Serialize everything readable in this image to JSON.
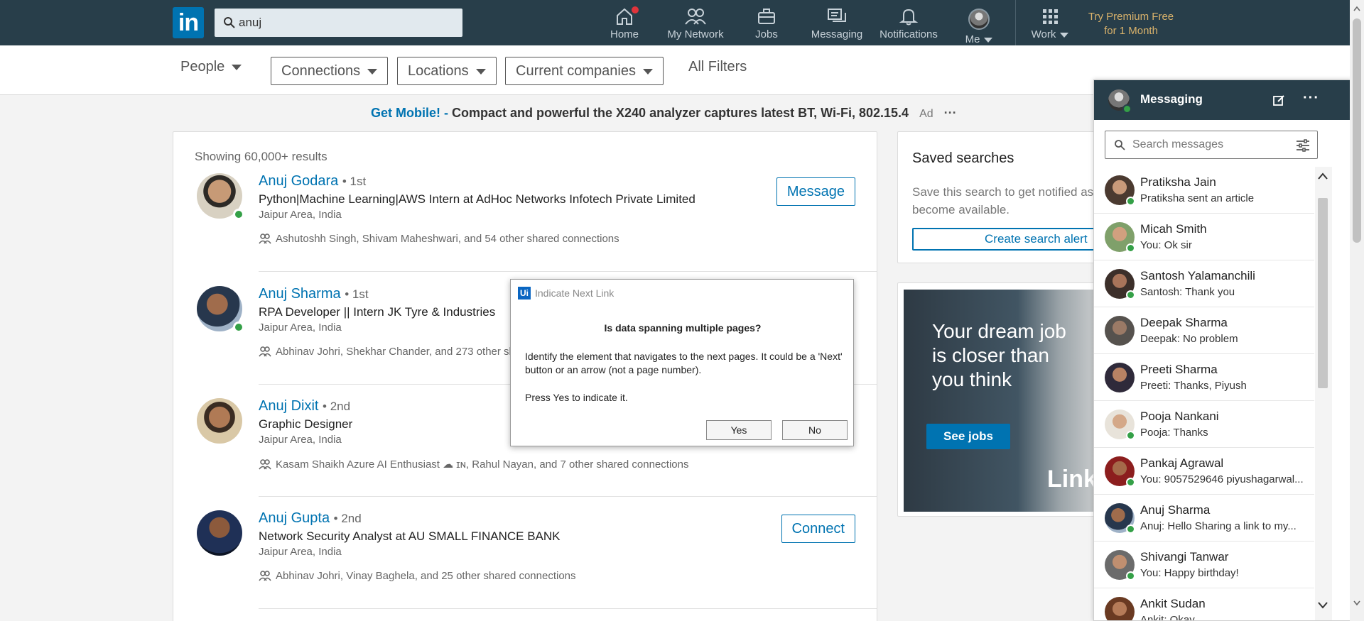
{
  "nav": {
    "search_value": "anuj",
    "items": [
      {
        "label": "Home",
        "icon": "home-icon"
      },
      {
        "label": "My Network",
        "icon": "network-icon"
      },
      {
        "label": "Jobs",
        "icon": "briefcase-icon"
      },
      {
        "label": "Messaging",
        "icon": "messaging-icon"
      },
      {
        "label": "Notifications",
        "icon": "bell-icon"
      },
      {
        "label": "Me",
        "icon": "avatar"
      },
      {
        "label": "Work",
        "icon": "grid-icon"
      }
    ],
    "premium_line1": "Try Premium Free",
    "premium_line2": "for 1 Month",
    "colors": {
      "bar": "#283e4a",
      "brand": "#0073b1",
      "premium": "#d9b26b",
      "badge": "#e0343b"
    }
  },
  "filters": {
    "people": "People",
    "buttons": [
      "Connections",
      "Locations",
      "Current companies"
    ],
    "all_filters": "All Filters"
  },
  "ad": {
    "link": "Get Mobile! -",
    "text": "Compact and powerful the X240 analyzer captures latest BT, Wi-Fi, 802.15.4",
    "tag": "Ad",
    "more": "···"
  },
  "results": {
    "count": "Showing 60,000+ results",
    "items": [
      {
        "name": "Anuj Godara",
        "degree": "• 1st",
        "title": "Python|Machine Learning|AWS Intern at AdHoc Networks Infotech Private Limited",
        "location": "Jaipur Area, India",
        "shared": "Ashutoshh Singh, Shivam Maheshwari, and 54 other shared connections",
        "button": "Message"
      },
      {
        "name": "Anuj Sharma",
        "degree": "• 1st",
        "title": "RPA Developer || Intern JK Tyre & Industries",
        "location": "Jaipur Area, India",
        "shared": "Abhinav Johri, Shekhar Chander, and 273 other sh",
        "button": ""
      },
      {
        "name": "Anuj Dixit",
        "degree": "• 2nd",
        "title": "Graphic Designer",
        "location": "Jaipur Area, India",
        "shared": "Kasam Shaikh Azure AI Enthusiast ☁ ɪɴ, Rahul Nayan, and 7 other shared connections",
        "button": ""
      },
      {
        "name": "Anuj Gupta",
        "degree": "• 2nd",
        "title": "Network Security Analyst at AU SMALL FINANCE BANK",
        "location": "Jaipur Area, India",
        "shared": "Abhinav Johri, Vinay Baghela, and 25 other shared connections",
        "button": "Connect"
      }
    ]
  },
  "saved": {
    "title": "Saved searches",
    "text_line1": "Save this search to get notified as",
    "text_line2": "become available.",
    "button": "Create search alert"
  },
  "ad_banner": {
    "headline": "Your dream job is closer than you think",
    "cta": "See jobs",
    "brand": "Linke"
  },
  "messaging": {
    "title": "Messaging",
    "search_placeholder": "Search messages",
    "conversations": [
      {
        "name": "Pratiksha Jain",
        "snippet": "Pratiksha sent an article"
      },
      {
        "name": "Micah Smith",
        "snippet": "You: Ok sir"
      },
      {
        "name": "Santosh Yalamanchili",
        "snippet": "Santosh: Thank you"
      },
      {
        "name": "Deepak Sharma",
        "snippet": "Deepak: No problem"
      },
      {
        "name": "Preeti Sharma",
        "snippet": "Preeti: Thanks, Piyush"
      },
      {
        "name": "Pooja Nankani",
        "snippet": "Pooja: Thanks"
      },
      {
        "name": "Pankaj Agrawal",
        "snippet": "You: 9057529646 piyushagarwal..."
      },
      {
        "name": "Anuj Sharma",
        "snippet": "Anuj: Hello Sharing a link to my..."
      },
      {
        "name": "Shivangi Tanwar",
        "snippet": "You: Happy birthday!"
      },
      {
        "name": "Ankit Sudan",
        "snippet": "Ankit: Okay"
      }
    ]
  },
  "dialog": {
    "logo": "Ui",
    "title": "Indicate Next Link",
    "question": "Is data spanning multiple pages?",
    "body": "Identify the element that navigates to the next pages. It could be a 'Next' button or an arrow (not a page number).",
    "press": "Press Yes to indicate it.",
    "yes": "Yes",
    "no": "No"
  }
}
